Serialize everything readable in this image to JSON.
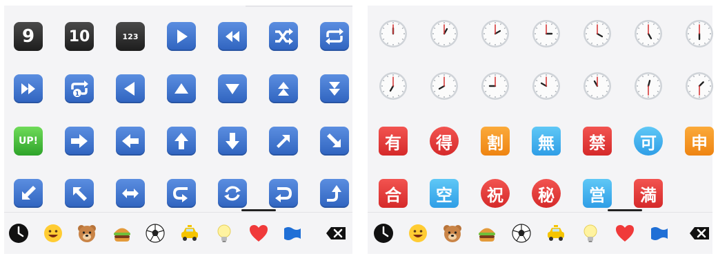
{
  "left_panel": {
    "rows": [
      [
        {
          "kind": "dark",
          "text": "9",
          "name": "keycap-9-icon"
        },
        {
          "kind": "dark",
          "text": "10",
          "name": "keycap-10-icon"
        },
        {
          "kind": "dark",
          "text": "123",
          "name": "input-numbers-icon"
        },
        {
          "kind": "blue",
          "name": "play-icon"
        },
        {
          "kind": "blue",
          "name": "rewind-icon"
        },
        {
          "kind": "blue",
          "name": "shuffle-icon"
        },
        {
          "kind": "blue",
          "name": "repeat-icon"
        }
      ],
      [
        {
          "kind": "blue",
          "name": "fast-forward-icon"
        },
        {
          "kind": "blue",
          "name": "repeat-one-icon"
        },
        {
          "kind": "blue",
          "name": "reverse-icon"
        },
        {
          "kind": "blue",
          "name": "up-button-icon"
        },
        {
          "kind": "blue",
          "name": "down-button-icon"
        },
        {
          "kind": "blue",
          "name": "fast-up-icon"
        },
        {
          "kind": "blue",
          "name": "fast-down-icon"
        }
      ],
      [
        {
          "kind": "green",
          "text": "UP!",
          "name": "up-exclamation-icon"
        },
        {
          "kind": "blue",
          "name": "arrow-right-icon"
        },
        {
          "kind": "blue",
          "name": "arrow-left-icon"
        },
        {
          "kind": "blue",
          "name": "arrow-up-icon"
        },
        {
          "kind": "blue",
          "name": "arrow-down-icon"
        },
        {
          "kind": "blue",
          "name": "arrow-up-right-icon"
        },
        {
          "kind": "blue",
          "name": "arrow-down-right-icon"
        }
      ],
      [
        {
          "kind": "blue",
          "name": "arrow-down-left-icon"
        },
        {
          "kind": "blue",
          "name": "arrow-up-left-icon"
        },
        {
          "kind": "blue",
          "name": "arrow-left-right-icon"
        },
        {
          "kind": "blue",
          "name": "right-arrow-curving-left-icon"
        },
        {
          "kind": "blue",
          "name": "counterclockwise-arrows-icon"
        },
        {
          "kind": "blue",
          "name": "left-arrow-curving-back-icon"
        },
        {
          "kind": "blue",
          "name": "right-arrow-curving-up-icon"
        }
      ]
    ]
  },
  "right_panel": {
    "clocks": [
      [
        [
          12,
          0
        ],
        [
          1,
          0
        ],
        [
          2,
          0
        ],
        [
          3,
          0
        ],
        [
          4,
          0
        ],
        [
          5,
          0
        ],
        [
          6,
          0
        ]
      ],
      [
        [
          7,
          0
        ],
        [
          8,
          0
        ],
        [
          9,
          0
        ],
        [
          10,
          0
        ],
        [
          11,
          0
        ],
        [
          12,
          30
        ],
        [
          1,
          30
        ]
      ]
    ],
    "signs": [
      [
        {
          "char": "有",
          "shape": "sq",
          "color": "red",
          "name": "japanese-not-free-of-charge-icon"
        },
        {
          "char": "得",
          "shape": "rd",
          "color": "red",
          "name": "japanese-bargain-icon"
        },
        {
          "char": "割",
          "shape": "sq",
          "color": "orange",
          "name": "japanese-discount-icon"
        },
        {
          "char": "無",
          "shape": "sq",
          "color": "lblue",
          "name": "japanese-free-of-charge-icon"
        },
        {
          "char": "禁",
          "shape": "sq",
          "color": "red",
          "name": "japanese-prohibited-icon"
        },
        {
          "char": "可",
          "shape": "rd",
          "color": "lblue",
          "name": "japanese-acceptable-icon"
        },
        {
          "char": "申",
          "shape": "sq",
          "color": "orange",
          "name": "japanese-application-icon"
        }
      ],
      [
        {
          "char": "合",
          "shape": "sq",
          "color": "red",
          "name": "japanese-passing-grade-icon"
        },
        {
          "char": "空",
          "shape": "sq",
          "color": "lblue",
          "name": "japanese-vacancy-icon"
        },
        {
          "char": "祝",
          "shape": "rd",
          "color": "red",
          "name": "japanese-congratulations-icon"
        },
        {
          "char": "秘",
          "shape": "rd",
          "color": "red",
          "name": "japanese-secret-icon"
        },
        {
          "char": "営",
          "shape": "sq",
          "color": "lblue",
          "name": "japanese-open-for-business-icon"
        },
        {
          "char": "満",
          "shape": "sq",
          "color": "red",
          "name": "japanese-no-vacancy-icon"
        }
      ]
    ]
  },
  "category_bar": [
    {
      "name": "recent-clock-icon"
    },
    {
      "name": "smileys-icon"
    },
    {
      "name": "animals-bear-icon"
    },
    {
      "name": "food-burger-icon"
    },
    {
      "name": "activity-soccer-icon"
    },
    {
      "name": "travel-taxi-icon"
    },
    {
      "name": "objects-lightbulb-icon"
    },
    {
      "name": "symbols-heart-icon"
    },
    {
      "name": "flags-icon"
    },
    {
      "name": "backspace-key-icon"
    }
  ],
  "colors": {
    "key_blue": "#2f63bf",
    "sign_red": "#d52a2a",
    "sign_orange": "#ee8412",
    "sign_lightblue": "#2f9ee6",
    "heart_red": "#f03a3a",
    "flag_blue": "#1f6fd6"
  }
}
